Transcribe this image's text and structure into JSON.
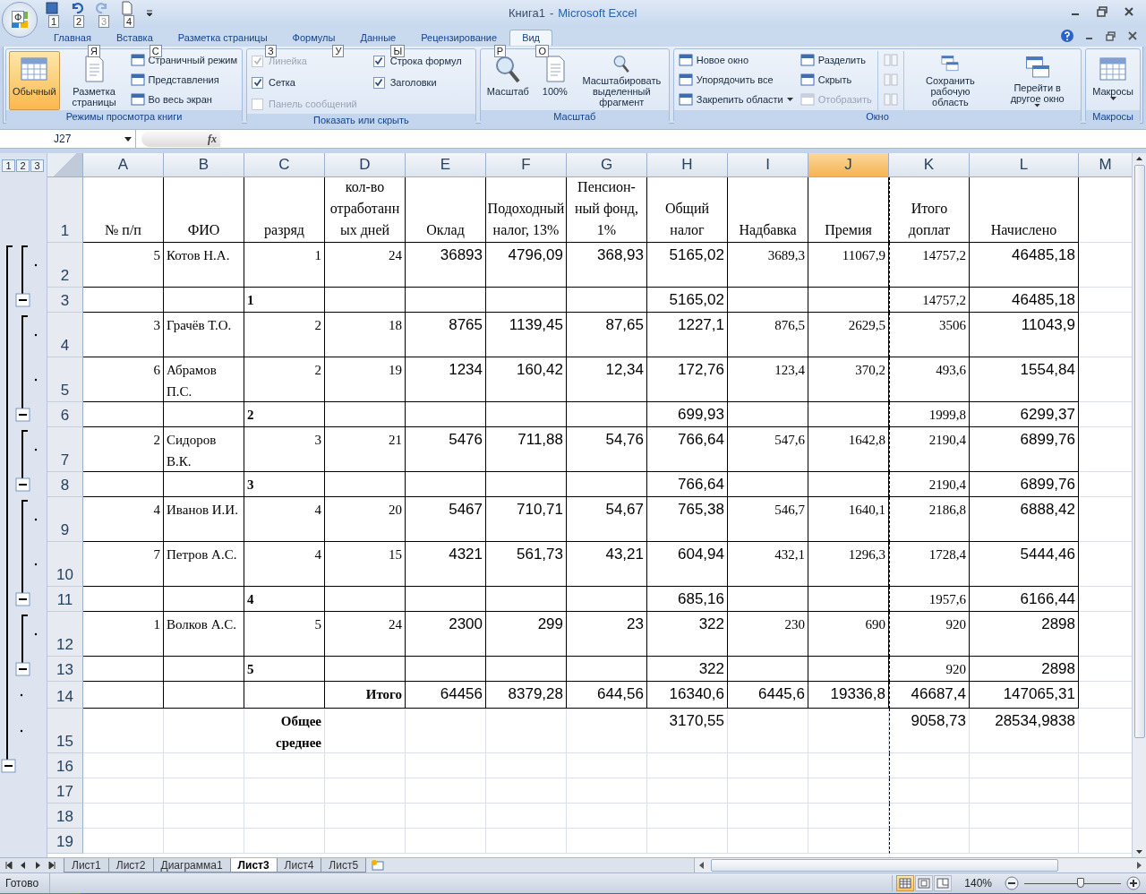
{
  "office_button": {
    "keytip": "Ф"
  },
  "quick_access": [
    {
      "keytip": "1",
      "disabled": false
    },
    {
      "keytip": "2",
      "disabled": false
    },
    {
      "keytip": "3",
      "disabled": true
    },
    {
      "keytip": "4",
      "disabled": false
    }
  ],
  "window": {
    "document": "Книга1",
    "separator": "-",
    "app": "Microsoft Excel"
  },
  "tabs": [
    {
      "label": "Главная",
      "keytip": "Я",
      "selected": false
    },
    {
      "label": "Вставка",
      "keytip": "С",
      "selected": false
    },
    {
      "label": "Разметка страницы",
      "keytip": "З",
      "selected": false
    },
    {
      "label": "Формулы",
      "keytip": "У",
      "selected": false
    },
    {
      "label": "Данные",
      "keytip": "Ы",
      "selected": false
    },
    {
      "label": "Рецензирование",
      "keytip": "Р",
      "selected": false
    },
    {
      "label": "Вид",
      "keytip": "О",
      "selected": true
    }
  ],
  "ribbon": [
    {
      "label": "Режимы просмотра книги",
      "columns": [
        [
          {
            "kind": "large",
            "label": "Обычный",
            "selected": true,
            "disabled": false
          }
        ],
        [
          {
            "kind": "large",
            "label": "Разметка страницы",
            "selected": false,
            "disabled": false
          }
        ],
        [
          {
            "kind": "small",
            "label": "Страничный режим",
            "disabled": false
          },
          {
            "kind": "small",
            "label": "Представления",
            "disabled": false
          },
          {
            "kind": "small",
            "label": "Во весь экран",
            "disabled": false
          }
        ]
      ]
    },
    {
      "label": "Показать или скрыть",
      "columns": [
        [
          {
            "kind": "checkbox",
            "label": "Линейка",
            "checked": true,
            "disabled": true
          },
          {
            "kind": "checkbox",
            "label": "Сетка",
            "checked": true,
            "disabled": false
          },
          {
            "kind": "checkbox",
            "label": "Панель сообщений",
            "checked": false,
            "disabled": true
          }
        ],
        [
          {
            "kind": "checkbox",
            "label": "Строка формул",
            "checked": true,
            "disabled": false
          },
          {
            "kind": "checkbox",
            "label": "Заголовки",
            "checked": true,
            "disabled": false
          }
        ]
      ]
    },
    {
      "label": "Масштаб",
      "columns": [
        [
          {
            "kind": "large",
            "label": "Масштаб",
            "disabled": false
          }
        ],
        [
          {
            "kind": "large",
            "label": "100%",
            "disabled": false
          }
        ],
        [
          {
            "kind": "large",
            "label": "Масштабировать выделенный фрагмент",
            "disabled": false
          }
        ]
      ]
    },
    {
      "label": "Окно",
      "columns": [
        [
          {
            "kind": "small",
            "label": "Новое окно",
            "disabled": false
          },
          {
            "kind": "small",
            "label": "Упорядочить все",
            "disabled": false
          },
          {
            "kind": "small",
            "label": "Закрепить области",
            "disabled": false,
            "dropdown": true
          }
        ],
        [
          {
            "kind": "small",
            "label": "Разделить",
            "disabled": false
          },
          {
            "kind": "small",
            "label": "Скрыть",
            "disabled": false
          },
          {
            "kind": "small",
            "label": "Отобразить",
            "disabled": true
          }
        ],
        [
          {
            "kind": "icon",
            "disabled": true
          },
          {
            "kind": "icon",
            "disabled": true
          },
          {
            "kind": "icon",
            "disabled": true
          }
        ],
        [
          {
            "kind": "large",
            "label": "Сохранить рабочую область",
            "disabled": false
          }
        ],
        [
          {
            "kind": "large",
            "label": "Перейти в другое окно",
            "disabled": false,
            "dropdown": true
          }
        ]
      ]
    },
    {
      "label": "Макросы",
      "columns": [
        [
          {
            "kind": "large",
            "label": "Макросы",
            "disabled": false,
            "dropdown": true
          }
        ]
      ]
    }
  ],
  "formula_bar": {
    "name_box": "J27",
    "fx": "fx"
  },
  "outline_levels": [
    "1",
    "2",
    "3"
  ],
  "columns": [
    {
      "label": "A",
      "selected": false
    },
    {
      "label": "B",
      "selected": false
    },
    {
      "label": "C",
      "selected": false
    },
    {
      "label": "D",
      "selected": false
    },
    {
      "label": "E",
      "selected": false
    },
    {
      "label": "F",
      "selected": false
    },
    {
      "label": "G",
      "selected": false
    },
    {
      "label": "H",
      "selected": false
    },
    {
      "label": "I",
      "selected": false
    },
    {
      "label": "J",
      "selected": true
    },
    {
      "label": "K",
      "selected": false
    },
    {
      "label": "L",
      "selected": false
    },
    {
      "label": "M",
      "selected": false
    }
  ],
  "rows": [
    {
      "header": "1",
      "kind": "header",
      "cells": [
        "№ п/п",
        "ФИО",
        "разряд",
        "кол-во отработанных дней",
        "Оклад",
        "Подоходный налог, 13%",
        "Пенсион-ный фонд, 1%",
        "Общий налог",
        "Надбавка",
        "Премия",
        "Итого доплат",
        "Начислено"
      ]
    },
    {
      "header": "2",
      "kind": "detail",
      "cells": [
        "5",
        "Котов Н.А.",
        "1",
        "24",
        "36893",
        "4796,09",
        "368,93",
        "5165,02",
        "3689,3",
        "11067,9",
        "14757,2",
        "46485,18"
      ]
    },
    {
      "header": "3",
      "kind": "subtotal",
      "cells": [
        "",
        "",
        "1",
        "",
        "",
        "",
        "",
        "5165,02",
        "",
        "",
        "14757,2",
        "46485,18"
      ]
    },
    {
      "header": "4",
      "kind": "detail",
      "cells": [
        "3",
        "Грачёв Т.О.",
        "2",
        "18",
        "8765",
        "1139,45",
        "87,65",
        "1227,1",
        "876,5",
        "2629,5",
        "3506",
        "11043,9"
      ]
    },
    {
      "header": "5",
      "kind": "detail",
      "cells": [
        "6",
        "Абрамов П.С.",
        "2",
        "19",
        "1234",
        "160,42",
        "12,34",
        "172,76",
        "123,4",
        "370,2",
        "493,6",
        "1554,84"
      ]
    },
    {
      "header": "6",
      "kind": "subtotal",
      "cells": [
        "",
        "",
        "2",
        "",
        "",
        "",
        "",
        "699,93",
        "",
        "",
        "1999,8",
        "6299,37"
      ]
    },
    {
      "header": "7",
      "kind": "detail",
      "cells": [
        "2",
        "Сидоров В.К.",
        "3",
        "21",
        "5476",
        "711,88",
        "54,76",
        "766,64",
        "547,6",
        "1642,8",
        "2190,4",
        "6899,76"
      ]
    },
    {
      "header": "8",
      "kind": "subtotal",
      "cells": [
        "",
        "",
        "3",
        "",
        "",
        "",
        "",
        "766,64",
        "",
        "",
        "2190,4",
        "6899,76"
      ]
    },
    {
      "header": "9",
      "kind": "detail",
      "cells": [
        "4",
        "Иванов И.И.",
        "4",
        "20",
        "5467",
        "710,71",
        "54,67",
        "765,38",
        "546,7",
        "1640,1",
        "2186,8",
        "6888,42"
      ]
    },
    {
      "header": "10",
      "kind": "detail",
      "cells": [
        "7",
        "Петров А.С.",
        "4",
        "15",
        "4321",
        "561,73",
        "43,21",
        "604,94",
        "432,1",
        "1296,3",
        "1728,4",
        "5444,46"
      ]
    },
    {
      "header": "11",
      "kind": "subtotal",
      "cells": [
        "",
        "",
        "4",
        "",
        "",
        "",
        "",
        "685,16",
        "",
        "",
        "1957,6",
        "6166,44"
      ]
    },
    {
      "header": "12",
      "kind": "detail",
      "cells": [
        "1",
        "Волков А.С.",
        "5",
        "24",
        "2300",
        "299",
        "23",
        "322",
        "230",
        "690",
        "920",
        "2898"
      ]
    },
    {
      "header": "13",
      "kind": "subtotal",
      "cells": [
        "",
        "",
        "5",
        "",
        "",
        "",
        "",
        "322",
        "",
        "",
        "920",
        "2898"
      ]
    },
    {
      "header": "14",
      "kind": "total",
      "cells": [
        "",
        "",
        "",
        "Итого",
        "64456",
        "8379,28",
        "644,56",
        "16340,6",
        "6445,6",
        "19336,8",
        "46687,4",
        "147065,31"
      ]
    },
    {
      "header": "15",
      "kind": "average",
      "cells": [
        "",
        "",
        "Общее среднее",
        "",
        "",
        "",
        "",
        "3170,55",
        "",
        "",
        "9058,73",
        "28534,9838"
      ]
    },
    {
      "header": "16",
      "kind": "outline_end",
      "cells": []
    },
    {
      "header": "17",
      "kind": "empty",
      "cells": []
    },
    {
      "header": "18",
      "kind": "empty",
      "cells": []
    },
    {
      "header": "19",
      "kind": "empty",
      "cells": []
    }
  ],
  "sheets": [
    {
      "label": "Лист1",
      "selected": false
    },
    {
      "label": "Лист2",
      "selected": false
    },
    {
      "label": "Диаграмма1",
      "selected": false
    },
    {
      "label": "Лист3",
      "selected": true
    },
    {
      "label": "Лист4",
      "selected": false
    },
    {
      "label": "Лист5",
      "selected": false
    }
  ],
  "status": {
    "text": "Готово",
    "views": [
      {
        "selected": true
      },
      {
        "selected": false
      },
      {
        "selected": false
      }
    ],
    "zoom": "140%",
    "zoom_slider": {
      "level": 0.58
    }
  }
}
